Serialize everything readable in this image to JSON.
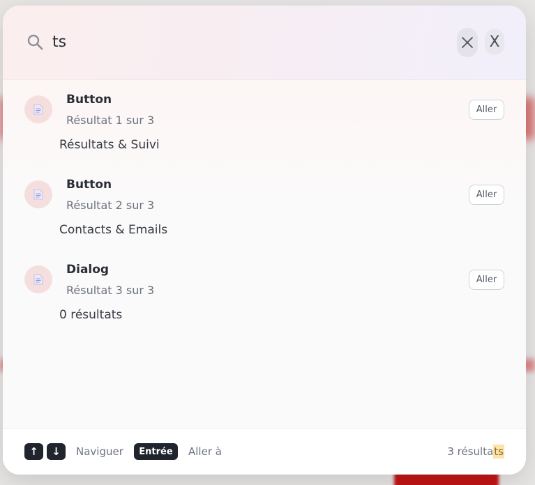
{
  "search": {
    "query": "ts",
    "clear_label": "×",
    "close_label": "X"
  },
  "results": [
    {
      "title": "Button",
      "subtitle": "Résultat 1 sur 3",
      "description": "Résultats & Suivi",
      "action": "Aller",
      "icon": "document-icon"
    },
    {
      "title": "Button",
      "subtitle": "Résultat 2 sur 3",
      "description": "Contacts & Emails",
      "action": "Aller",
      "icon": "document-icon"
    },
    {
      "title": "Dialog",
      "subtitle": "Résultat 3 sur 3",
      "description": "0 résultats",
      "action": "Aller",
      "icon": "document-icon"
    }
  ],
  "footer": {
    "up_key": "↑",
    "down_key": "↓",
    "navigate_label": "Naviguer",
    "enter_key": "Entrée",
    "goto_label": "Aller à",
    "count_prefix": "3 résulta",
    "count_highlight": "ts"
  },
  "colors": {
    "accent_dark": "#1f242d",
    "icon_bg": "#f5dede",
    "highlight": "#fde3a7"
  }
}
